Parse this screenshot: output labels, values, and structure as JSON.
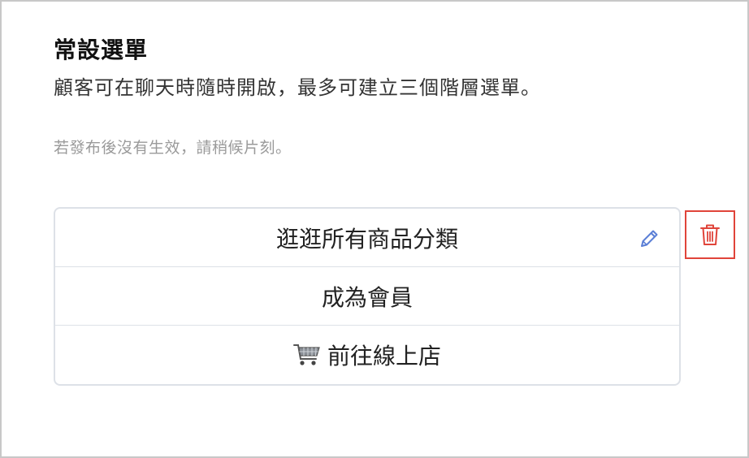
{
  "section": {
    "title": "常設選單",
    "description": "顧客可在聊天時隨時開啟，最多可建立三個階層選單。",
    "note": "若發布後沒有生效，請稍候片刻。"
  },
  "menu": {
    "items": [
      {
        "label": "逛逛所有商品分類",
        "icon": null
      },
      {
        "label": "成為會員",
        "icon": null
      },
      {
        "label": "前往線上店",
        "icon": "shopping-cart-icon"
      }
    ]
  },
  "actions": {
    "edit_icon": "pencil-icon",
    "delete_icon": "trash-icon"
  },
  "colors": {
    "edit_icon": "#5b7fd6",
    "delete_icon": "#e0443a",
    "delete_border": "#e0443a",
    "box_border": "#dde1e7",
    "note_text": "#9a9a9a"
  }
}
